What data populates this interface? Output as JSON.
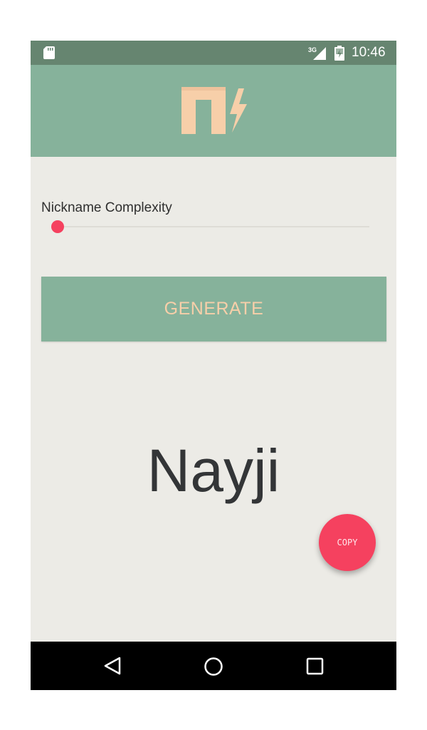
{
  "status_bar": {
    "time": "10:46",
    "network": "3G",
    "icons": [
      "sd-card-icon",
      "signal-icon",
      "battery-charging-icon"
    ]
  },
  "app_bar": {
    "logo": "nickname-bolt-logo"
  },
  "settings": {
    "complexity_label": "Nickname Complexity",
    "complexity_value": 0
  },
  "actions": {
    "generate_label": "GENERATE",
    "copy_label": "COPY"
  },
  "result": {
    "nickname": "Nayji"
  },
  "navigation": {
    "buttons": [
      "back-icon",
      "home-icon",
      "recents-icon"
    ]
  },
  "colors": {
    "primary": "#86b29b",
    "status_bar": "#668570",
    "accent": "#f5415f",
    "logo_and_button_text": "#f7cfa9",
    "background": "#ecebe6"
  }
}
